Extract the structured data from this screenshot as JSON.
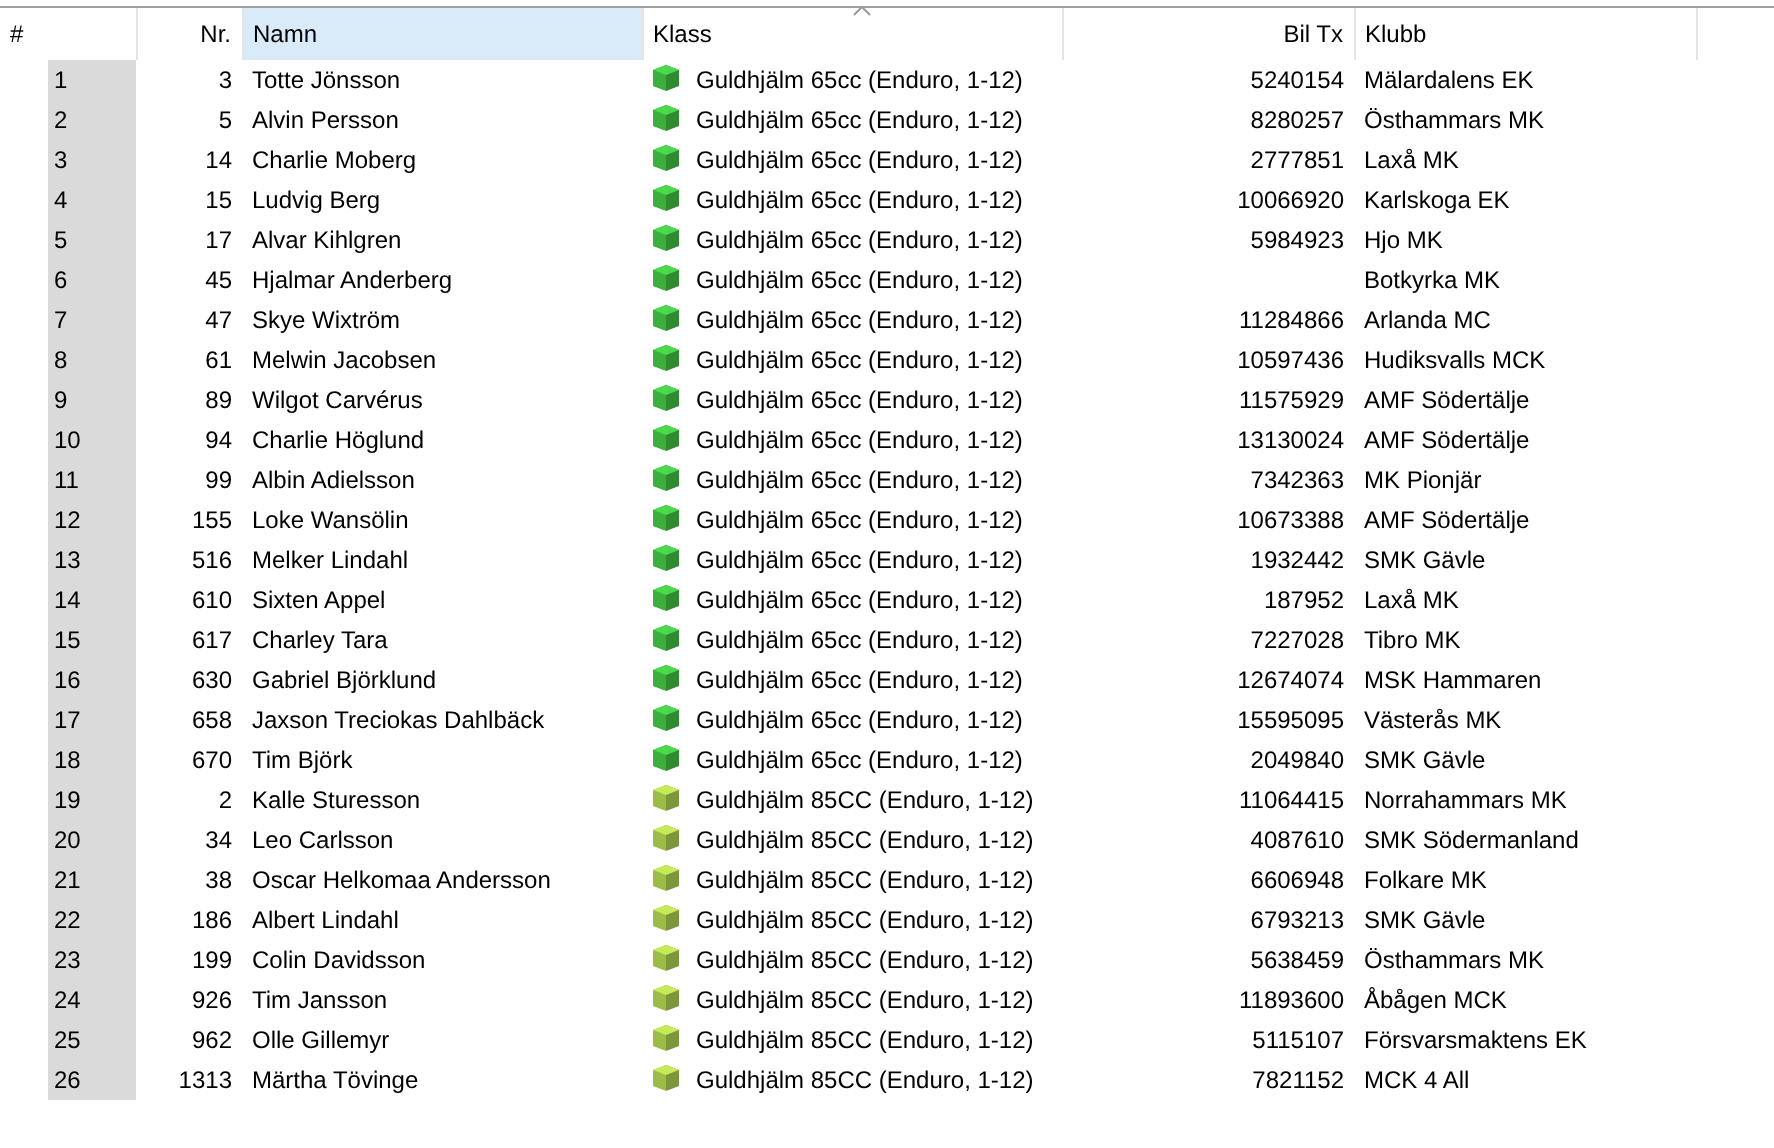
{
  "table": {
    "columns": [
      {
        "label": "#",
        "selected": false,
        "sorted": false
      },
      {
        "label": "Nr.",
        "selected": false,
        "sorted": false
      },
      {
        "label": "Namn",
        "selected": true,
        "sorted": false
      },
      {
        "label": "Klass",
        "selected": false,
        "sorted": true
      },
      {
        "label": "Bil Tx",
        "selected": false,
        "sorted": false
      },
      {
        "label": "Klubb",
        "selected": false,
        "sorted": false
      }
    ],
    "rows": [
      {
        "index": "1",
        "nr": "3",
        "name": "Totte Jönsson",
        "class": "Guldhjälm 65cc (Enduro, 1-12)",
        "color": "#3cae3c",
        "bil_tx": "5240154",
        "club": "Mälardalens EK"
      },
      {
        "index": "2",
        "nr": "5",
        "name": "Alvin Persson",
        "class": "Guldhjälm 65cc (Enduro, 1-12)",
        "color": "#3cae3c",
        "bil_tx": "8280257",
        "club": "Östhammars MK"
      },
      {
        "index": "3",
        "nr": "14",
        "name": "Charlie Moberg",
        "class": "Guldhjälm 65cc (Enduro, 1-12)",
        "color": "#3cae3c",
        "bil_tx": "2777851",
        "club": "Laxå MK"
      },
      {
        "index": "4",
        "nr": "15",
        "name": "Ludvig Berg",
        "class": "Guldhjälm 65cc (Enduro, 1-12)",
        "color": "#3cae3c",
        "bil_tx": "10066920",
        "club": "Karlskoga EK"
      },
      {
        "index": "5",
        "nr": "17",
        "name": "Alvar Kihlgren",
        "class": "Guldhjälm 65cc (Enduro, 1-12)",
        "color": "#3cae3c",
        "bil_tx": "5984923",
        "club": "Hjo MK"
      },
      {
        "index": "6",
        "nr": "45",
        "name": "Hjalmar Anderberg",
        "class": "Guldhjälm 65cc (Enduro, 1-12)",
        "color": "#3cae3c",
        "club": "Botkyrka MK"
      },
      {
        "index": "7",
        "nr": "47",
        "name": "Skye Wixtröm",
        "class": "Guldhjälm 65cc (Enduro, 1-12)",
        "color": "#3cae3c",
        "bil_tx": "11284866",
        "club": "Arlanda MC"
      },
      {
        "index": "8",
        "nr": "61",
        "name": "Melwin Jacobsen",
        "class": "Guldhjälm 65cc (Enduro, 1-12)",
        "color": "#3cae3c",
        "bil_tx": "10597436",
        "club": "Hudiksvalls MCK"
      },
      {
        "index": "9",
        "nr": "89",
        "name": "Wilgot Carvérus",
        "class": "Guldhjälm 65cc (Enduro, 1-12)",
        "color": "#3cae3c",
        "bil_tx": "11575929",
        "club": "AMF Södertälje"
      },
      {
        "index": "10",
        "nr": "94",
        "name": "Charlie Höglund",
        "class": "Guldhjälm 65cc (Enduro, 1-12)",
        "color": "#3cae3c",
        "bil_tx": "13130024",
        "club": "AMF Södertälje"
      },
      {
        "index": "11",
        "nr": "99",
        "name": "Albin Adielsson",
        "class": "Guldhjälm 65cc (Enduro, 1-12)",
        "color": "#3cae3c",
        "bil_tx": "7342363",
        "club": "MK Pionjär"
      },
      {
        "index": "12",
        "nr": "155",
        "name": "Loke Wansölin",
        "class": "Guldhjälm 65cc (Enduro, 1-12)",
        "color": "#3cae3c",
        "bil_tx": "10673388",
        "club": "AMF Södertälje"
      },
      {
        "index": "13",
        "nr": "516",
        "name": "Melker Lindahl",
        "class": "Guldhjälm 65cc (Enduro, 1-12)",
        "color": "#3cae3c",
        "bil_tx": "1932442",
        "club": "SMK Gävle"
      },
      {
        "index": "14",
        "nr": "610",
        "name": "Sixten Appel",
        "class": "Guldhjälm 65cc (Enduro, 1-12)",
        "color": "#3cae3c",
        "bil_tx": "187952",
        "club": "Laxå MK"
      },
      {
        "index": "15",
        "nr": "617",
        "name": "Charley Tara",
        "class": "Guldhjälm 65cc (Enduro, 1-12)",
        "color": "#3cae3c",
        "bil_tx": "7227028",
        "club": "Tibro MK"
      },
      {
        "index": "16",
        "nr": "630",
        "name": "Gabriel Björklund",
        "class": "Guldhjälm 65cc (Enduro, 1-12)",
        "color": "#3cae3c",
        "bil_tx": "12674074",
        "club": "MSK Hammaren"
      },
      {
        "index": "17",
        "nr": "658",
        "name": "Jaxson Treciokas Dahlbäck",
        "class": "Guldhjälm 65cc (Enduro, 1-12)",
        "color": "#3cae3c",
        "bil_tx": "15595095",
        "club": "Västerås MK"
      },
      {
        "index": "18",
        "nr": "670",
        "name": "Tim Björk",
        "class": "Guldhjälm 65cc (Enduro, 1-12)",
        "color": "#3cae3c",
        "bil_tx": "2049840",
        "club": "SMK Gävle"
      },
      {
        "index": "19",
        "nr": "2",
        "name": "Kalle Sturesson",
        "class": "Guldhjälm 85CC (Enduro, 1-12)",
        "color": "#9cbc48",
        "bil_tx": "11064415",
        "club": "Norrahammars MK"
      },
      {
        "index": "20",
        "nr": "34",
        "name": "Leo Carlsson",
        "class": "Guldhjälm 85CC (Enduro, 1-12)",
        "color": "#9cbc48",
        "bil_tx": "4087610",
        "club": "SMK Södermanland"
      },
      {
        "index": "21",
        "nr": "38",
        "name": "Oscar Helkomaa Andersson",
        "class": "Guldhjälm 85CC (Enduro, 1-12)",
        "color": "#9cbc48",
        "bil_tx": "6606948",
        "club": "Folkare MK"
      },
      {
        "index": "22",
        "nr": "186",
        "name": "Albert Lindahl",
        "class": "Guldhjälm 85CC (Enduro, 1-12)",
        "color": "#9cbc48",
        "bil_tx": "6793213",
        "club": "SMK Gävle"
      },
      {
        "index": "23",
        "nr": "199",
        "name": "Colin Davidsson",
        "class": "Guldhjälm 85CC (Enduro, 1-12)",
        "color": "#9cbc48",
        "bil_tx": "5638459",
        "club": "Östhammars MK"
      },
      {
        "index": "24",
        "nr": "926",
        "name": "Tim Jansson",
        "class": "Guldhjälm 85CC (Enduro, 1-12)",
        "color": "#9cbc48",
        "bil_tx": "11893600",
        "club": "Åbågen MCK"
      },
      {
        "index": "25",
        "nr": "962",
        "name": "Olle Gillemyr",
        "class": "Guldhjälm 85CC (Enduro, 1-12)",
        "color": "#9cbc48",
        "bil_tx": "5115107",
        "club": "Försvarsmaktens EK"
      },
      {
        "index": "26",
        "nr": "1313",
        "name": "Märtha Tövinge",
        "class": "Guldhjälm 85CC (Enduro, 1-12)",
        "color": "#9cbc48",
        "bil_tx": "7821152",
        "club": "MCK 4 All"
      }
    ]
  }
}
